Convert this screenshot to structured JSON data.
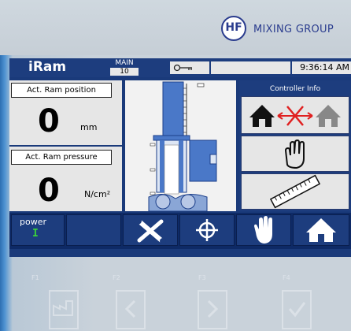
{
  "header": {
    "logo_mark": "HF",
    "logo_text": "MIXING GROUP"
  },
  "topbar": {
    "app_name": "iRam",
    "menu_label": "MAIN",
    "menu_number": "10",
    "time": "9:36:14 AM"
  },
  "position_panel": {
    "label": "Act. Ram position",
    "value": "0",
    "unit": "mm"
  },
  "pressure_panel": {
    "label": "Act. Ram pressure",
    "value": "0",
    "unit": "N/cm²"
  },
  "controller": {
    "title": "Controller Info"
  },
  "bottom_bar": {
    "power_label": "power",
    "power_state": "I"
  },
  "fkeys": [
    "F1",
    "F2",
    "F3",
    "F4"
  ],
  "colors": {
    "screen": "#1a3a7a",
    "ram_blue": "#4a78c8",
    "power_green": "#3ad13a",
    "cross_red": "#e02020"
  }
}
